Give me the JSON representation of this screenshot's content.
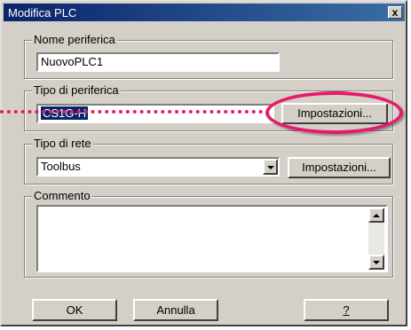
{
  "window": {
    "title": "Modifica PLC",
    "close_label": "x"
  },
  "device_name": {
    "label": "Nome periferica",
    "value": "NuovoPLC1"
  },
  "device_type": {
    "label": "Tipo di periferica",
    "value": "CS1G-H",
    "settings_label": "Impostazioni..."
  },
  "network_type": {
    "label": "Tipo di rete",
    "value": "Toolbus",
    "settings_label": "Impostazioni..."
  },
  "comment": {
    "label": "Commento",
    "value": ""
  },
  "buttons": {
    "ok": "OK",
    "cancel": "Annulla",
    "help": "?"
  },
  "colors": {
    "titlebar_start": "#0a246a",
    "titlebar_end": "#3a6ea5",
    "highlight": "#e6196c",
    "selection": "#0a246a"
  }
}
